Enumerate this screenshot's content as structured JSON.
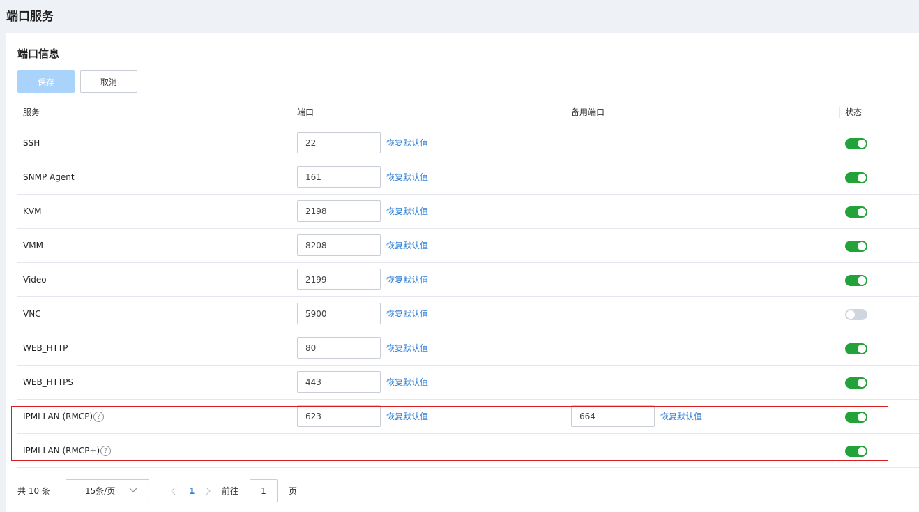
{
  "page": {
    "title": "端口服务"
  },
  "section": {
    "title": "端口信息"
  },
  "toolbar": {
    "save_label": "保存",
    "cancel_label": "取消"
  },
  "table": {
    "headers": {
      "service": "服务",
      "port": "端口",
      "backup_port": "备用端口",
      "status": "状态"
    },
    "restore_label": "恢复默认值",
    "rows": [
      {
        "service": "SSH",
        "port": "22",
        "enabled": true
      },
      {
        "service": "SNMP Agent",
        "port": "161",
        "enabled": true
      },
      {
        "service": "KVM",
        "port": "2198",
        "enabled": true
      },
      {
        "service": "VMM",
        "port": "8208",
        "enabled": true
      },
      {
        "service": "Video",
        "port": "2199",
        "enabled": true
      },
      {
        "service": "VNC",
        "port": "5900",
        "enabled": false
      },
      {
        "service": "WEB_HTTP",
        "port": "80",
        "enabled": true
      },
      {
        "service": "WEB_HTTPS",
        "port": "443",
        "enabled": true
      },
      {
        "service": "IPMI LAN (RMCP)",
        "port": "623",
        "backup_port": "664",
        "enabled": true,
        "help": "?"
      },
      {
        "service": "IPMI LAN (RMCP+)",
        "enabled": true,
        "help": "?"
      }
    ]
  },
  "pagination": {
    "total": "共 10 条",
    "page_size": "15条/页",
    "current_page": "1",
    "goto_label": "前往",
    "goto_value": "1",
    "page_suffix": "页"
  },
  "colors": {
    "accent": "#2f7fd8",
    "toggle_on": "#22a33a",
    "toggle_off": "#d0d6e0",
    "highlight": "#d81e1e"
  }
}
